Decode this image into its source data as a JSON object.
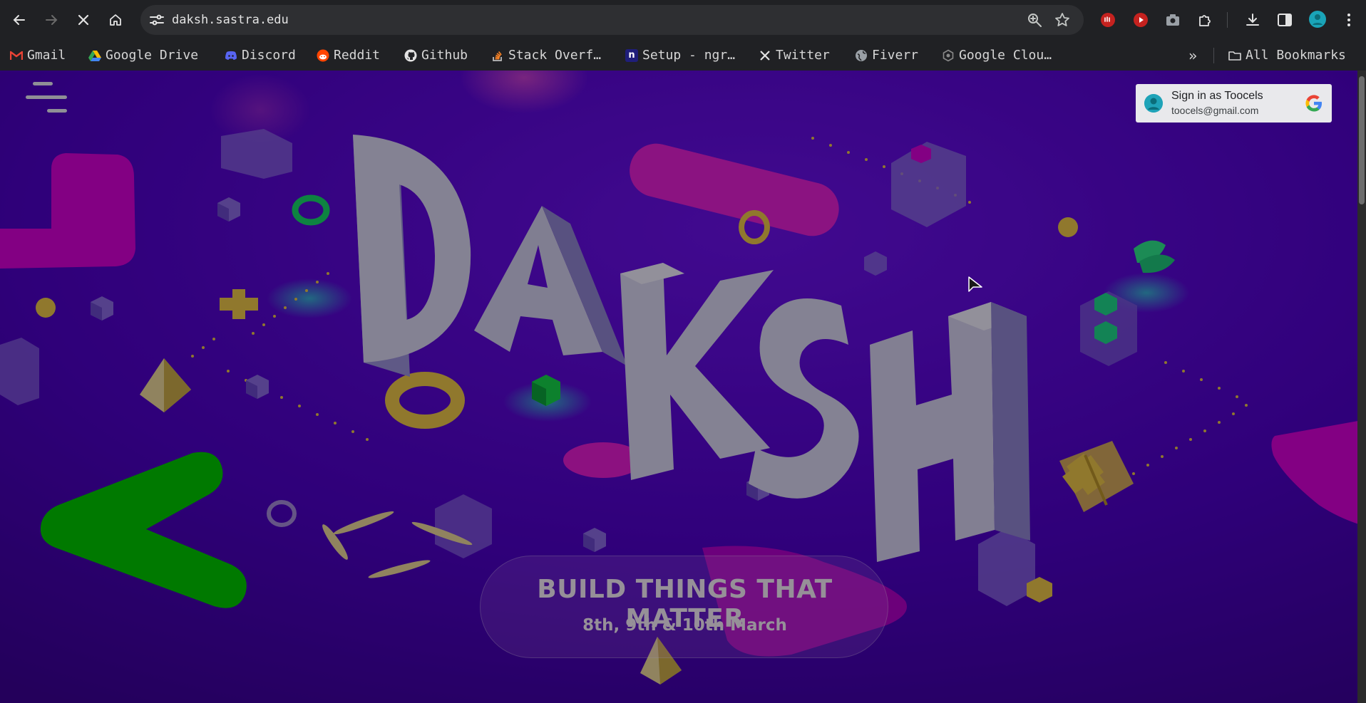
{
  "browser": {
    "url": "daksh.sastra.edu",
    "bookmarks": [
      {
        "label": "Gmail",
        "icon": "gmail-icon",
        "color": "#ea4335"
      },
      {
        "label": "Google Drive",
        "icon": "google-drive-icon",
        "color": "#34a853"
      },
      {
        "label": "Discord",
        "icon": "discord-icon",
        "color": "#5865f2"
      },
      {
        "label": "Reddit",
        "icon": "reddit-icon",
        "color": "#ff4500"
      },
      {
        "label": "Github",
        "icon": "github-icon",
        "color": "#e3e3e3"
      },
      {
        "label": "Stack Overf…",
        "icon": "stack-overflow-icon",
        "color": "#f48024"
      },
      {
        "label": "Setup - ngr…",
        "icon": "ngrok-icon",
        "color": "#1f1e7a"
      },
      {
        "label": "Twitter",
        "icon": "x-twitter-icon",
        "color": "#e3e3e3"
      },
      {
        "label": "Fiverr",
        "icon": "globe-icon",
        "color": "#c4c7c5"
      },
      {
        "label": "Google Clou…",
        "icon": "google-cloud-icon",
        "color": "#8a8a8a"
      }
    ],
    "bookmarks_overflow": "»",
    "all_bookmarks": "All Bookmarks"
  },
  "page": {
    "brand": "DAKSH",
    "signin": {
      "title": "Sign in as Toocels",
      "email": "toocels@gmail.com"
    },
    "cta": {
      "title": "BUILD THINGS THAT MATTER",
      "dates": "8th, 9th & 10th March"
    },
    "colors": {
      "background": "#4a00b6",
      "magenta": "#d400d4",
      "green": "#00c400",
      "gold": "#e8c24a",
      "letters": "#cfcfe6"
    }
  }
}
